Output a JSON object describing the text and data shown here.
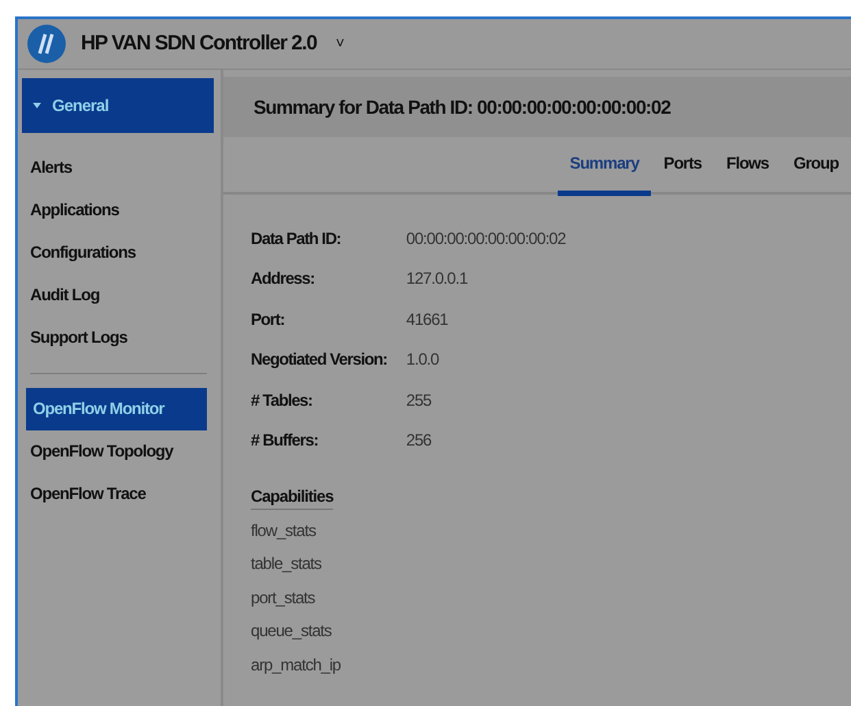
{
  "header": {
    "title": "HP VAN SDN Controller 2.0",
    "dropdown": "˅"
  },
  "sidebar": {
    "section": {
      "label": "General",
      "expanded": true
    },
    "groups": [
      [
        {
          "label": "Alerts",
          "selected": false
        },
        {
          "label": "Applications",
          "selected": false
        },
        {
          "label": "Configurations",
          "selected": false
        },
        {
          "label": "Audit Log",
          "selected": false
        },
        {
          "label": "Support Logs",
          "selected": false
        }
      ],
      [
        {
          "label": "OpenFlow Monitor",
          "selected": true
        },
        {
          "label": "OpenFlow Topology",
          "selected": false
        },
        {
          "label": "OpenFlow Trace",
          "selected": false
        }
      ]
    ]
  },
  "content": {
    "title": "Summary for Data Path ID: 00:00:00:00:00:00:00:02",
    "tabs": [
      {
        "label": "Summary",
        "selected": true
      },
      {
        "label": "Ports",
        "selected": false
      },
      {
        "label": "Flows",
        "selected": false
      },
      {
        "label": "Group",
        "selected": false
      }
    ],
    "fields": [
      {
        "label": "Data Path ID:",
        "value": "00:00:00:00:00:00:00:02"
      },
      {
        "label": "Address:",
        "value": "127.0.0.1"
      },
      {
        "label": "Port:",
        "value": "41661"
      },
      {
        "label": "Negotiated Version:",
        "value": "1.0.0"
      },
      {
        "label": "# Tables:",
        "value": "255"
      },
      {
        "label": "# Buffers:",
        "value": "256"
      }
    ],
    "capabilities_title": "Capabilities",
    "capabilities": [
      "flow_stats",
      "table_stats",
      "port_stats",
      "queue_stats",
      "arp_match_ip"
    ]
  }
}
